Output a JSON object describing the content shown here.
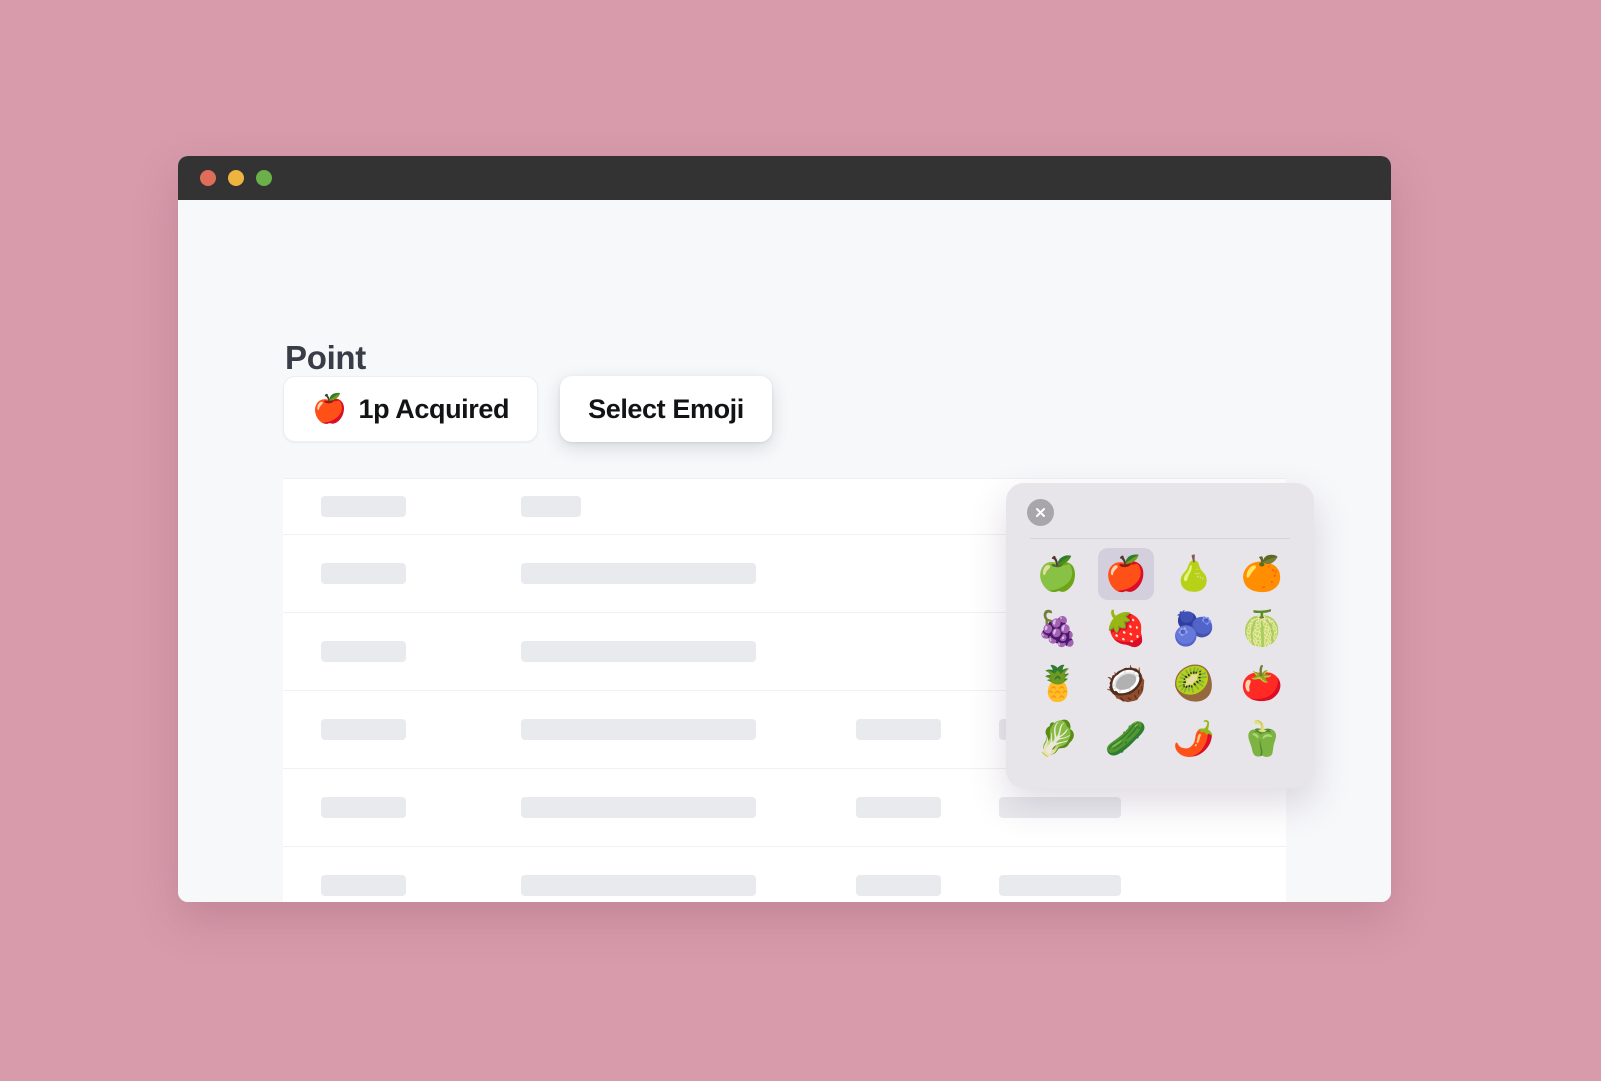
{
  "window": {
    "traffic_lights": [
      {
        "name": "close",
        "color": "#e06c5a"
      },
      {
        "name": "minimize",
        "color": "#eeb43f"
      },
      {
        "name": "zoom",
        "color": "#6cb04a"
      }
    ]
  },
  "page": {
    "title": "Point"
  },
  "controls": {
    "point_button": {
      "emoji": "🍎",
      "label": "1p Acquired"
    },
    "select_emoji_button": {
      "label": "Select Emoji"
    }
  },
  "table": {
    "rows": [
      {
        "type": "header",
        "chips": [
          "c1",
          "c2s"
        ]
      },
      {
        "type": "body",
        "chips": [
          "c1",
          "c2"
        ]
      },
      {
        "type": "body",
        "chips": [
          "c1",
          "c2"
        ]
      },
      {
        "type": "body",
        "chips": [
          "c1",
          "c2",
          "c3",
          "c4"
        ]
      },
      {
        "type": "body",
        "chips": [
          "c1",
          "c2",
          "c3",
          "c4"
        ]
      },
      {
        "type": "body",
        "chips": [
          "c1",
          "c2",
          "c3",
          "c4"
        ]
      },
      {
        "type": "body",
        "chips": []
      }
    ]
  },
  "emoji_picker": {
    "close_label": "×",
    "selected_index": 1,
    "emojis": [
      {
        "char": "🍏",
        "name": "green-apple"
      },
      {
        "char": "🍎",
        "name": "red-apple"
      },
      {
        "char": "🍐",
        "name": "pear"
      },
      {
        "char": "🍊",
        "name": "tangerine"
      },
      {
        "char": "🍇",
        "name": "grapes"
      },
      {
        "char": "🍓",
        "name": "strawberry"
      },
      {
        "char": "🫐",
        "name": "blueberries"
      },
      {
        "char": "🍈",
        "name": "melon"
      },
      {
        "char": "🍍",
        "name": "pineapple"
      },
      {
        "char": "🥥",
        "name": "coconut"
      },
      {
        "char": "🥝",
        "name": "kiwi-fruit"
      },
      {
        "char": "🍅",
        "name": "tomato"
      },
      {
        "char": "🥬",
        "name": "leafy-green"
      },
      {
        "char": "🥒",
        "name": "cucumber"
      },
      {
        "char": "🌶️",
        "name": "hot-pepper"
      },
      {
        "char": "🫑",
        "name": "bell-pepper"
      }
    ]
  },
  "colors": {
    "background": "#d79bab",
    "titlebar": "#333333",
    "app_background": "#f7f8fa",
    "picker_background": "#e7e4ea",
    "picker_selected": "#d4cfdd",
    "skeleton": "#e9eaee",
    "title_text": "#383d47"
  }
}
